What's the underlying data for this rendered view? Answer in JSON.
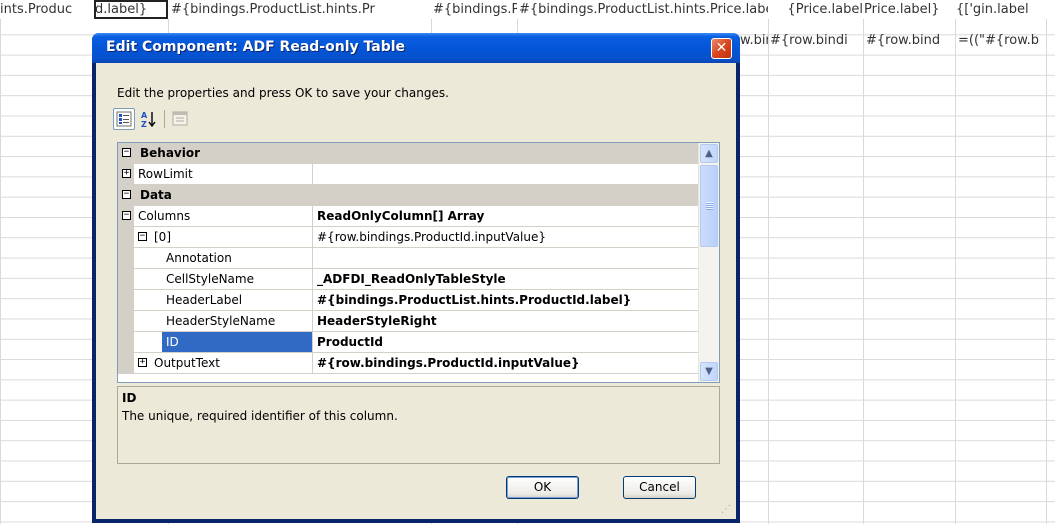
{
  "spreadsheet": {
    "header_cells": [
      "ints.ProductId.label}",
      "#{bindings.ProductList.hints.Pr",
      "#{bindings.Pr",
      "#{bindings.ProductList.hints.Price.label}",
      "Price.label}",
      "Price.label}",
      "gin.label']}"
    ],
    "row2_cells": [
      "w.bir",
      "#{row.bindi",
      "#{row.bind",
      "=((\"#{row.b"
    ]
  },
  "dialog": {
    "title": "Edit Component: ADF Read-only Table",
    "close_glyph": "✕",
    "instructions": "Edit the properties and press OK to save your changes.",
    "toolbar": {
      "categorized_icon": "categorized-icon",
      "alphabetical_icon": "sort-alphabetical-icon",
      "property_pages_icon": "property-pages-icon"
    },
    "grid": {
      "rows": [
        {
          "type": "category",
          "toggle": "−",
          "label": "Behavior"
        },
        {
          "type": "prop",
          "toggle": "+",
          "name": "RowLimit",
          "value": "",
          "indent": 0
        },
        {
          "type": "category",
          "toggle": "−",
          "label": "Data"
        },
        {
          "type": "prop",
          "toggle": "−",
          "name": "Columns",
          "value": "ReadOnlyColumn[] Array",
          "bold": true,
          "indent": 0
        },
        {
          "type": "prop",
          "toggle": "−",
          "name": "[0]",
          "value": "#{row.bindings.ProductId.inputValue}",
          "bold": false,
          "indent": 1
        },
        {
          "type": "prop",
          "toggle": "",
          "name": "Annotation",
          "value": "",
          "indent": 2
        },
        {
          "type": "prop",
          "toggle": "",
          "name": "CellStyleName",
          "value": "_ADFDI_ReadOnlyTableStyle",
          "bold": true,
          "indent": 2
        },
        {
          "type": "prop",
          "toggle": "",
          "name": "HeaderLabel",
          "value": "#{bindings.ProductList.hints.ProductId.label}",
          "bold": true,
          "indent": 2
        },
        {
          "type": "prop",
          "toggle": "",
          "name": "HeaderStyleName",
          "value": "HeaderStyleRight",
          "bold": true,
          "indent": 2
        },
        {
          "type": "prop",
          "toggle": "",
          "name": "ID",
          "value": "ProductId",
          "bold": true,
          "indent": 2,
          "selected": true
        },
        {
          "type": "prop",
          "toggle": "+",
          "name": "OutputText",
          "value": "#{row.bindings.ProductId.inputValue}",
          "bold": true,
          "indent": 1
        }
      ]
    },
    "description": {
      "title": "ID",
      "text": "The unique, required identifier of this column."
    },
    "ok_label": "OK",
    "cancel_label": "Cancel"
  }
}
